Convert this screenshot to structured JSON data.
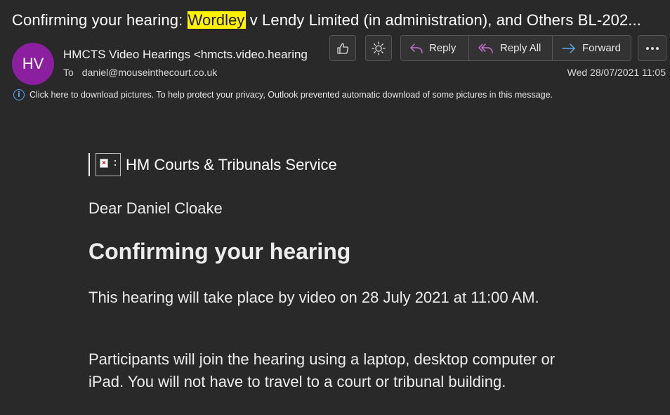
{
  "subject": {
    "prefix": "Confirming your hearing: ",
    "highlight": "Wordley",
    "rest": " v Lendy Limited (in administration), and Others BL-202..."
  },
  "sender": {
    "initials": "HV",
    "avatar_color": "#8b1fa0",
    "from": "HMCTS Video Hearings <hmcts.video.hearing",
    "to_label": "To",
    "to_address": "daniel@mouseinthecourt.co.uk",
    "date": "Wed 28/07/2021 11:05"
  },
  "toolbar": {
    "like_icon": "thumbs-up-icon",
    "sun_icon": "sun-icon",
    "reply_label": "Reply",
    "reply_all_label": "Reply All",
    "forward_label": "Forward",
    "more_label": "•••",
    "reply_color": "#c86fd6",
    "forward_color": "#5aa7ef"
  },
  "notice": {
    "icon": "info-icon",
    "text": "Click here to download pictures. To help protect your privacy, Outlook prevented automatic download of some pictures in this message."
  },
  "body": {
    "org_name": "HM Courts & Tribunals Service",
    "greeting": "Dear Daniel Cloake",
    "heading": "Confirming your hearing",
    "para1": "This hearing will take place by video on 28 July 2021 at 11:00 AM.",
    "para2": "Participants will join the hearing using a laptop, desktop computer or iPad. You will not have to travel to a court or tribunal building."
  }
}
